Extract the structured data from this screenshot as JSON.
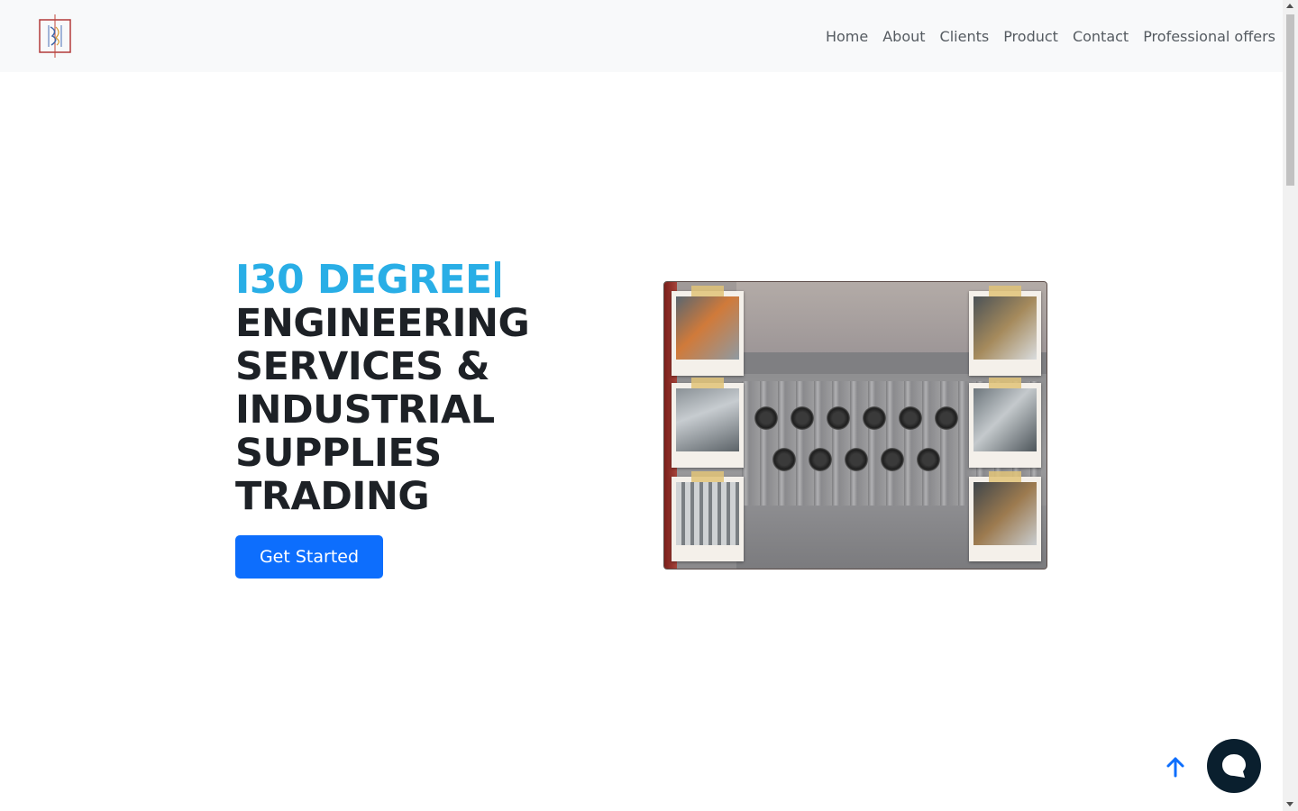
{
  "header": {
    "logo_icon": "company-logo-icon",
    "nav": [
      {
        "label": "Home"
      },
      {
        "label": "About"
      },
      {
        "label": "Clients"
      },
      {
        "label": "Product"
      },
      {
        "label": "Contact"
      },
      {
        "label": "Professional offers"
      }
    ]
  },
  "hero": {
    "title_accent": "I30 DEGREE",
    "title_lines": [
      "ENGINEERING",
      "SERVICES &",
      "INDUSTRIAL",
      "SUPPLIES",
      "TRADING"
    ],
    "cta_label": "Get Started",
    "image_alt": "electric meter bank with installation photos"
  },
  "floating": {
    "scroll_top_icon": "arrow-up-icon",
    "chat_icon": "chat-bubble-icon"
  },
  "colors": {
    "accent": "#29aee6",
    "primary_button": "#0d6efd",
    "chat_button": "#0a1f2e",
    "header_bg": "#f8f9fa"
  }
}
